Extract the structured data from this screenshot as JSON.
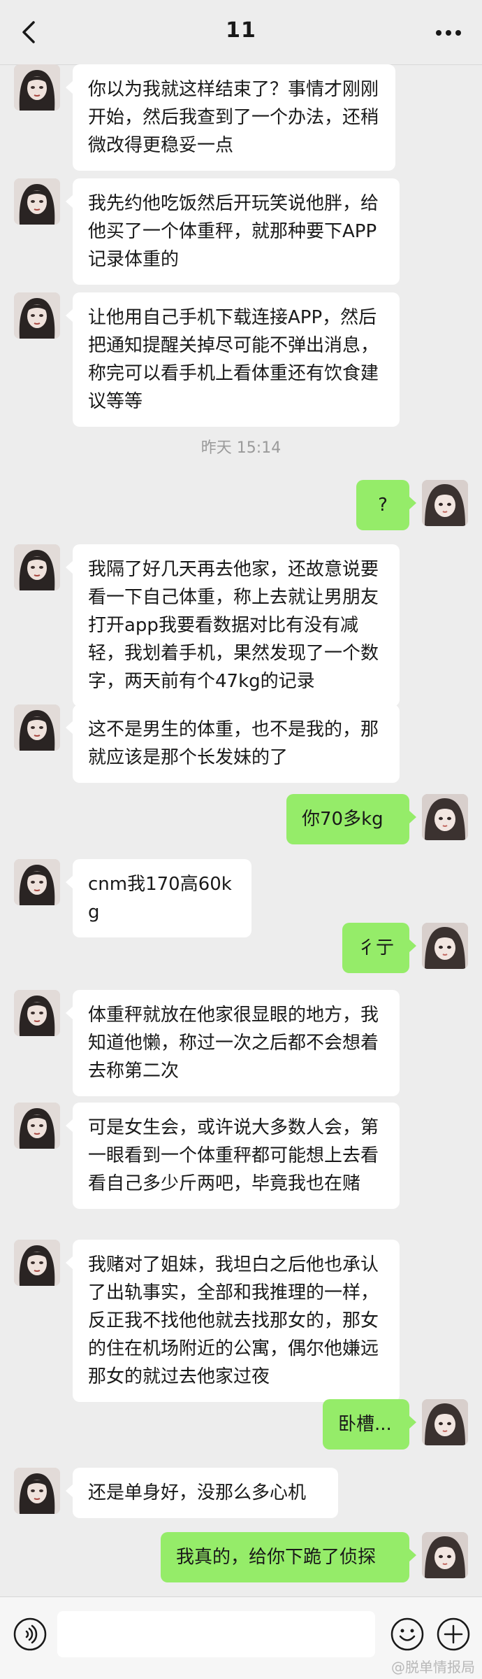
{
  "header": {
    "title": "11"
  },
  "timestamp": "昨天 15:14",
  "messages": [
    {
      "side": "in",
      "text": "你以为我就这样结束了？事情才刚刚开始，然后我查到了一个办法，还稍微改得更稳妥一点"
    },
    {
      "side": "in",
      "text": "我先约他吃饭然后开玩笑说他胖，给他买了一个体重秤，就那种要下APP记录体重的"
    },
    {
      "side": "in",
      "text": "让他用自己手机下载连接APP，然后把通知提醒关掉尽可能不弹出消息，称完可以看手机上看体重还有饮食建议等等"
    },
    {
      "side": "out",
      "text": "?"
    },
    {
      "side": "in",
      "text": "我隔了好几天再去他家，还故意说要看一下自己体重，称上去就让男朋友打开app我要看数据对比有没有减轻，我划着手机，果然发现了一个数字，两天前有个47kg的记录"
    },
    {
      "side": "in",
      "text": "这不是男生的体重，也不是我的，那就应该是那个长发妹的了"
    },
    {
      "side": "out",
      "text": "你70多kg"
    },
    {
      "side": "in",
      "text": "cnm我170高60kg"
    },
    {
      "side": "out",
      "text": "彳亍"
    },
    {
      "side": "in",
      "text": "体重秤就放在他家很显眼的地方，我知道他懒，称过一次之后都不会想着去称第二次"
    },
    {
      "side": "in",
      "text": "可是女生会，或许说大多数人会，第一眼看到一个体重秤都可能想上去看看自己多少斤两吧，毕竟我也在赌"
    },
    {
      "side": "in",
      "text": "我赌对了姐妹，我坦白之后他也承认了出轨事实，全部和我推理的一样，反正我不找他他就去找那女的，那女的住在机场附近的公寓，偶尔他嫌远那女的就过去他家过夜"
    },
    {
      "side": "out",
      "text": "卧槽..."
    },
    {
      "side": "in",
      "text": "还是单身好，没那么多心机"
    },
    {
      "side": "out",
      "text": "我真的，给你下跪了侦探"
    }
  ],
  "watermark": "@脱单情报局",
  "colors": {
    "sent_bubble": "#95ec69",
    "received_bubble": "#ffffff",
    "background": "#ededed"
  },
  "icons": {
    "back": "chevron-left-icon",
    "more": "ellipsis-icon",
    "voice": "voice-icon",
    "emoji": "emoji-icon",
    "plus": "plus-icon"
  }
}
